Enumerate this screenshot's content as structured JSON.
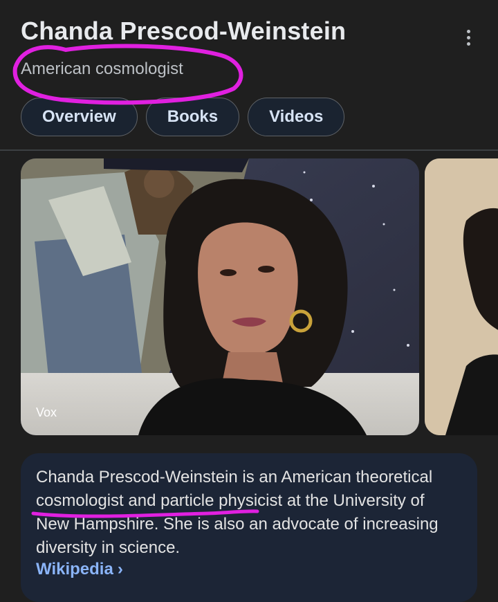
{
  "header": {
    "title": "Chanda Prescod-Weinstein",
    "subtitle": "American cosmologist",
    "more_icon": "more-vert-icon"
  },
  "tabs": [
    {
      "label": "Overview"
    },
    {
      "label": "Books"
    },
    {
      "label": "Videos"
    }
  ],
  "images": {
    "main_source": "Vox"
  },
  "description": {
    "text": "Chanda Prescod-Weinstein is an American theoretical cosmologist and particle physicist at the University of New Hampshire. She is also an advocate of increasing diversity in science.",
    "source_link": "Wikipedia",
    "chevron_icon": "chevron-right-icon"
  },
  "colors": {
    "background": "#1f1f1f",
    "chip_bg": "#1a2330",
    "card_bg": "#1c2536",
    "link": "#8ab4f8",
    "annotation": "#e020e0"
  }
}
